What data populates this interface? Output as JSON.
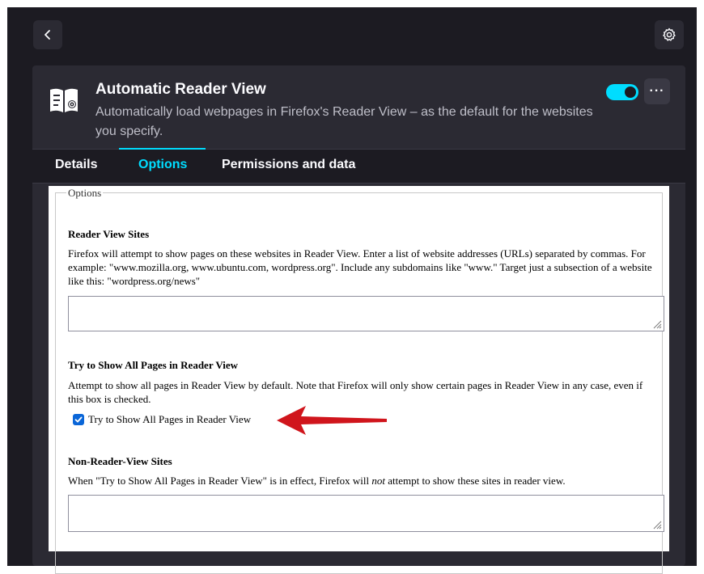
{
  "header": {
    "back_icon": "chevron-left-icon",
    "settings_icon": "gear-icon"
  },
  "extension": {
    "name": "Automatic Reader View",
    "description": "Automatically load webpages in Firefox's Reader View – as the default for the websites you specify.",
    "enabled": true,
    "more_label": "···"
  },
  "tabs": [
    {
      "label": "Details",
      "active": false
    },
    {
      "label": "Options",
      "active": true
    },
    {
      "label": "Permissions and data",
      "active": false
    }
  ],
  "options": {
    "legend": "Options",
    "reader_view_sites": {
      "heading": "Reader View Sites",
      "description": "Firefox will attempt to show pages on these websites in Reader View. Enter a list of website addresses (URLs) separated by commas. For example: \"www.mozilla.org, www.ubuntu.com, wordpress.org\". Include any subdomains like \"www.\" Target just a subsection of a website like this: \"wordpress.org/news\"",
      "value": ""
    },
    "all_pages": {
      "heading": "Try to Show All Pages in Reader View",
      "description": "Attempt to show all pages in Reader View by default. Note that Firefox will only show certain pages in Reader View in any case, even if this box is checked.",
      "checkbox_label": "Try to Show All Pages in Reader View",
      "checked": true
    },
    "non_reader_sites": {
      "heading": "Non-Reader-View Sites",
      "description_pre": "When \"Try to Show All Pages in Reader View\" is in effect, Firefox will ",
      "description_em": "not",
      "description_post": " attempt to show these sites in reader view.",
      "value": ""
    }
  },
  "colors": {
    "accent": "#00ddff",
    "checkbox": "#0a66d8",
    "annotation_arrow": "#d0151c"
  }
}
